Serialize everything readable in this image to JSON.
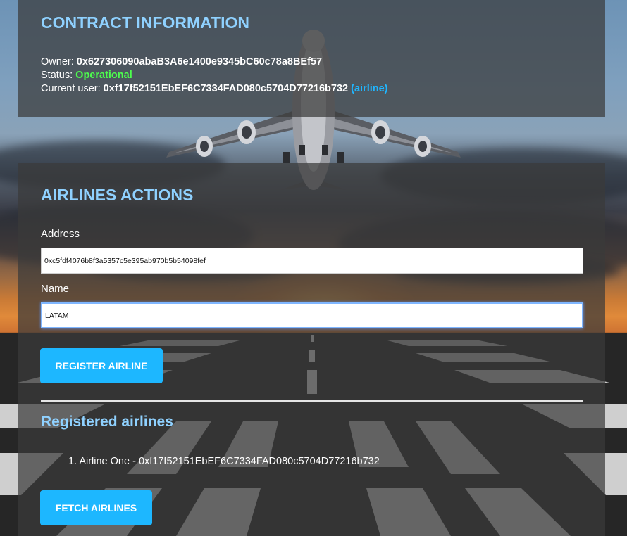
{
  "contract": {
    "title": "CONTRACT INFORMATION",
    "owner_label": "Owner:",
    "owner_value": "0x627306090abaB3A6e1400e9345bC60c78a8BEf57",
    "status_label": "Status:",
    "status_value": "Operational",
    "current_user_label": "Current user:",
    "current_user_value": "0xf17f52151EbEF6C7334FAD080c5704D77216b732",
    "current_user_role": "(airline)"
  },
  "airlines": {
    "title": "AIRLINES ACTIONS",
    "address_label": "Address",
    "address_value": "0xc5fdf4076b8f3a5357c5e395ab970b5b54098fef",
    "name_label": "Name",
    "name_value": "LATAM",
    "register_button": "REGISTER AIRLINE",
    "registered_title": "Registered airlines",
    "registered_list": [
      {
        "index": "1.",
        "text": "Airline One - 0xf17f52151EbEF6C7334FAD080c5704D77216b732"
      }
    ],
    "fetch_button": "FETCH AIRLINES"
  },
  "colors": {
    "accent_title": "#8fd1ff",
    "button": "#1db7ff",
    "status_operational": "#4dff4d",
    "role": "#1fb6ff"
  },
  "icons": {
    "background": "airplane-runway-sunset-image"
  }
}
